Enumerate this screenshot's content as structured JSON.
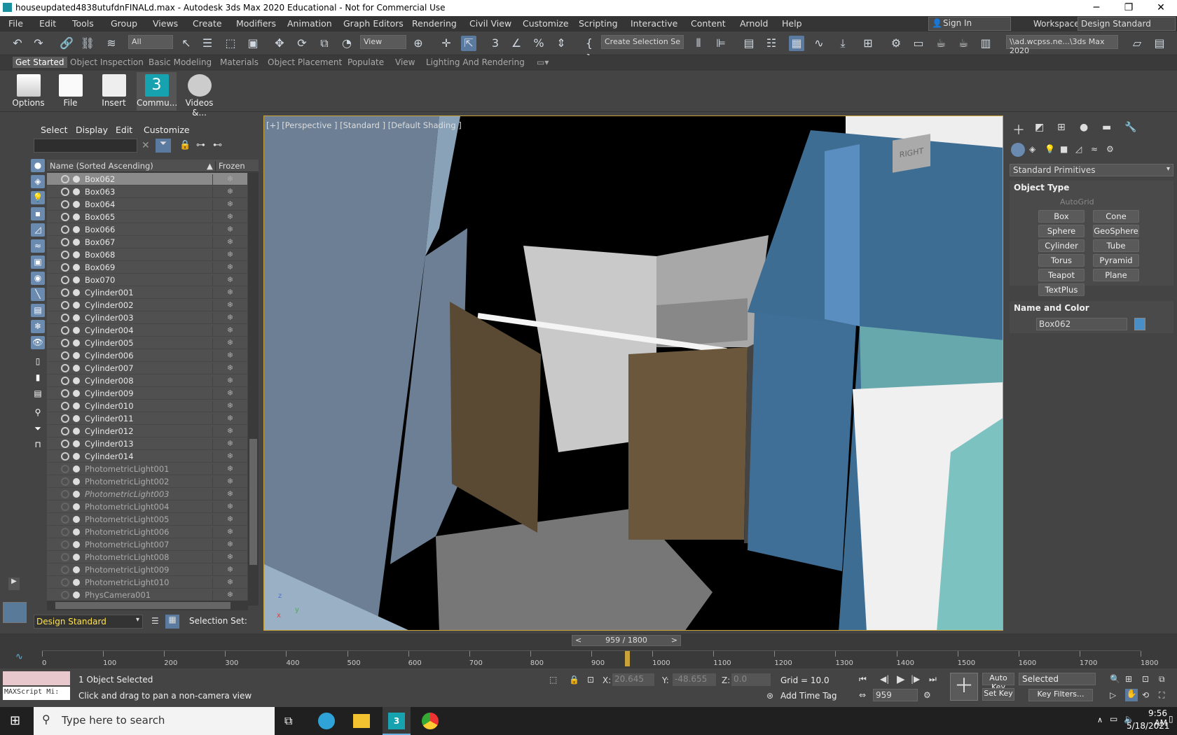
{
  "title_bar": {
    "title": "houseupdated4838utufdnFINALd.max - Autodesk 3ds Max 2020 Educational - Not for Commercial Use",
    "min": "─",
    "max": "❐",
    "close": "✕"
  },
  "menu": [
    "File",
    "Edit",
    "Tools",
    "Group",
    "Views",
    "Create",
    "Modifiers",
    "Animation",
    "Graph Editors",
    "Rendering",
    "Civil View",
    "Customize",
    "Scripting",
    "Interactive",
    "Content",
    "Arnold",
    "Help"
  ],
  "signin": "Sign In",
  "workspaces_label": "Workspaces:",
  "workspace_value": "Design Standard",
  "toolbar": {
    "filter": "All",
    "view": "View",
    "selset": "Create Selection Se",
    "path": "\\\\ad.wcpss.ne...\\3ds Max 2020"
  },
  "ribbon_tabs": [
    "Get Started",
    "Object Inspection",
    "Basic Modeling",
    "Materials",
    "Object Placement",
    "Populate",
    "View",
    "Lighting And Rendering"
  ],
  "ribbon_buttons": [
    "Options",
    "File",
    "Insert",
    "Commu...",
    "Videos &..."
  ],
  "scene": {
    "menu": [
      "Select",
      "Display",
      "Edit",
      "Customize"
    ],
    "col_name": "Name (Sorted Ascending)",
    "col_frozen": "Frozen",
    "rows": [
      {
        "name": "Box062",
        "type": "obj",
        "sel": true
      },
      {
        "name": "Box063",
        "type": "obj"
      },
      {
        "name": "Box064",
        "type": "obj"
      },
      {
        "name": "Box065",
        "type": "obj"
      },
      {
        "name": "Box066",
        "type": "obj"
      },
      {
        "name": "Box067",
        "type": "obj"
      },
      {
        "name": "Box068",
        "type": "obj"
      },
      {
        "name": "Box069",
        "type": "obj"
      },
      {
        "name": "Box070",
        "type": "obj"
      },
      {
        "name": "Cylinder001",
        "type": "obj"
      },
      {
        "name": "Cylinder002",
        "type": "obj"
      },
      {
        "name": "Cylinder003",
        "type": "obj"
      },
      {
        "name": "Cylinder004",
        "type": "obj"
      },
      {
        "name": "Cylinder005",
        "type": "obj"
      },
      {
        "name": "Cylinder006",
        "type": "obj"
      },
      {
        "name": "Cylinder007",
        "type": "obj"
      },
      {
        "name": "Cylinder008",
        "type": "obj"
      },
      {
        "name": "Cylinder009",
        "type": "obj"
      },
      {
        "name": "Cylinder010",
        "type": "obj"
      },
      {
        "name": "Cylinder011",
        "type": "obj"
      },
      {
        "name": "Cylinder012",
        "type": "obj"
      },
      {
        "name": "Cylinder013",
        "type": "obj"
      },
      {
        "name": "Cylinder014",
        "type": "obj"
      },
      {
        "name": "PhotometricLight001",
        "type": "light"
      },
      {
        "name": "PhotometricLight002",
        "type": "light"
      },
      {
        "name": "PhotometricLight003",
        "type": "light",
        "italic": true
      },
      {
        "name": "PhotometricLight004",
        "type": "light"
      },
      {
        "name": "PhotometricLight005",
        "type": "light"
      },
      {
        "name": "PhotometricLight006",
        "type": "light"
      },
      {
        "name": "PhotometricLight007",
        "type": "light"
      },
      {
        "name": "PhotometricLight008",
        "type": "light"
      },
      {
        "name": "PhotometricLight009",
        "type": "light"
      },
      {
        "name": "PhotometricLight010",
        "type": "light"
      },
      {
        "name": "PhysCamera001",
        "type": "light"
      }
    ],
    "layer": "Design Standard",
    "selection_set": "Selection Set:"
  },
  "viewport": {
    "label": "[+] [Perspective ] [Standard ] [Default Shading ]",
    "cube": "RIGHT",
    "axis_x": "x",
    "axis_y": "y",
    "axis_z": "z"
  },
  "cmd": {
    "dropdown": "Standard Primitives",
    "rollout1": "Object Type",
    "autogrid": "AutoGrid",
    "buttons": [
      "Box",
      "Cone",
      "Sphere",
      "GeoSphere",
      "Cylinder",
      "Tube",
      "Torus",
      "Pyramid",
      "Teapot",
      "Plane",
      "TextPlus"
    ],
    "rollout2": "Name and Color",
    "name": "Box062",
    "color": "#4a8ec8"
  },
  "timeline": {
    "frame": "959 / 1800",
    "current": 959,
    "end": 1800,
    "ticks": [
      "0",
      "100",
      "200",
      "300",
      "400",
      "500",
      "600",
      "700",
      "800",
      "900",
      "1000",
      "1100",
      "1200",
      "1300",
      "1400",
      "1500",
      "1600",
      "1700",
      "1800"
    ]
  },
  "status": {
    "maxscript": "MAXScript Mi:",
    "selected": "1 Object Selected",
    "prompt": "Click and drag to pan a non-camera view",
    "x_label": "X:",
    "x": "20.645",
    "y_label": "Y:",
    "y": "-48.655",
    "z_label": "Z:",
    "z": "0.0",
    "grid": "Grid = 10.0",
    "addtime": "Add Time Tag",
    "autokey": "Auto Key",
    "setkey": "Set Key",
    "selected_dd": "Selected",
    "keyfilters": "Key Filters...",
    "frame": "959"
  },
  "taskbar": {
    "search": "Type here to search",
    "time": "9:56 AM",
    "date": "5/18/2021"
  }
}
